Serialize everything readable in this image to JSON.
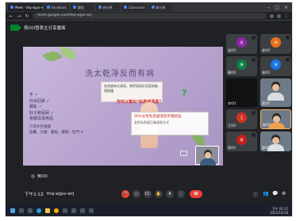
{
  "browser": {
    "tabs": [
      {
        "label": "Meet - thq-wjpo-wrj"
      },
      {
        "label": "Facebook"
      },
      {
        "label": "課程"
      },
      {
        "label": "新分頁"
      },
      {
        "label": "Classroom"
      },
      {
        "label": "新分頁"
      }
    ],
    "url": "meet.google.com/thq-wjpo-wrj"
  },
  "meet": {
    "title": "吳OO發表主分享畫面"
  },
  "slide": {
    "title": "洗太乾淨反而有病",
    "list": [
      "手 ✓",
      "外出回家 ✓",
      "腳趾 ✓",
      "肚子和屁屁 ✓",
      "身體清潔用品"
    ],
    "bottom_note_1": "只洗外生殖器",
    "bottom_note_2": "陰囊、大腿、腹股、腳底、肛門 ✗",
    "box1_text": "私密處每天清潔，頻率過高反而容易破壞保護",
    "red_line": "你可以寫出“私密處清潔”",
    "question_mark": "?",
    "box2_line1": "90%女性私密處清潔步驟錯誤",
    "box2_line2": "女性私密處正確清潔方式"
  },
  "presenter": {
    "name": "吳OO"
  },
  "participants": [
    {
      "name": "吳OO",
      "initial": "吳",
      "color": "#8e24aa",
      "camera": false
    },
    {
      "name": "林OO",
      "initial": "林",
      "color": "#e8711a",
      "camera": false
    },
    {
      "name": "陳OO",
      "initial": "陳",
      "color": "#0b8043",
      "camera": false
    },
    {
      "name": "張OO",
      "initial": "張",
      "color": "#1a73e8",
      "camera": false
    },
    {
      "name": "李OO",
      "initial": "",
      "color": "#111111",
      "camera": false
    },
    {
      "name": "黃OO",
      "initial": "",
      "color": "#6e7b86",
      "camera": true
    },
    {
      "name": "王OO",
      "initial": "王",
      "color": "#d93025",
      "camera": false
    },
    {
      "name": "謝OO",
      "initial": "",
      "color": "#6e7b86",
      "camera": true
    },
    {
      "name": "周OO",
      "initial": "周",
      "color": "#c5221f",
      "camera": false
    },
    {
      "name": "鄭OO 等 17 位",
      "initial": "",
      "color": "#6e7b86",
      "camera": true
    }
  ],
  "toolbar": {
    "time": "下午2:12",
    "meeting_code": "thq-wjpo-wrj"
  },
  "taskbar": {
    "time": "下午 02:12",
    "date": "2022/10/18"
  }
}
